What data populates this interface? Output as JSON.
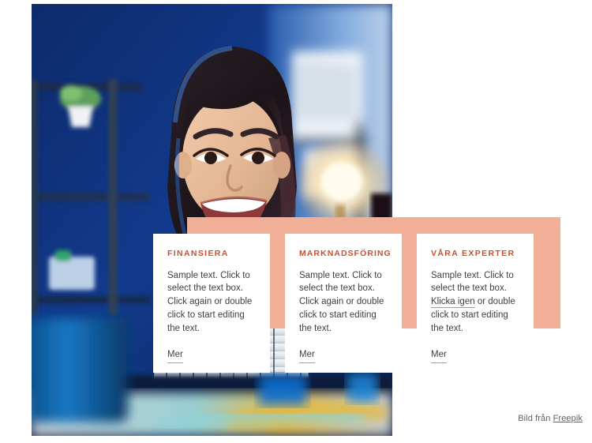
{
  "hero": {
    "image_alt": "smiling-woman-at-desk-in-blue-lit-office",
    "band_color": "#F2AF97"
  },
  "theme": {
    "accent": "#C8512F",
    "band": "#F2AF97",
    "text": "#3d4043",
    "muted": "#5f6368"
  },
  "cards": [
    {
      "title": "FINANSIERA",
      "body_before": "Sample text. Click to select the text box. Click again or double click to start editing the text.",
      "link_text": "",
      "body_after": "",
      "more_label": "Mer"
    },
    {
      "title": "MARKNADSFÖRING",
      "body_before": "Sample text. Click to select the text box. Click again or double click to start editing the text.",
      "link_text": "",
      "body_after": "",
      "more_label": "Mer"
    },
    {
      "title": "VÅRA EXPERTER",
      "body_before": "Sample text. Click to select the text box. ",
      "link_text": "Klicka igen",
      "body_after": " or double click to start editing the text.",
      "more_label": "Mer"
    }
  ],
  "credit": {
    "prefix": "Bild från ",
    "link_label": "Freepik"
  }
}
